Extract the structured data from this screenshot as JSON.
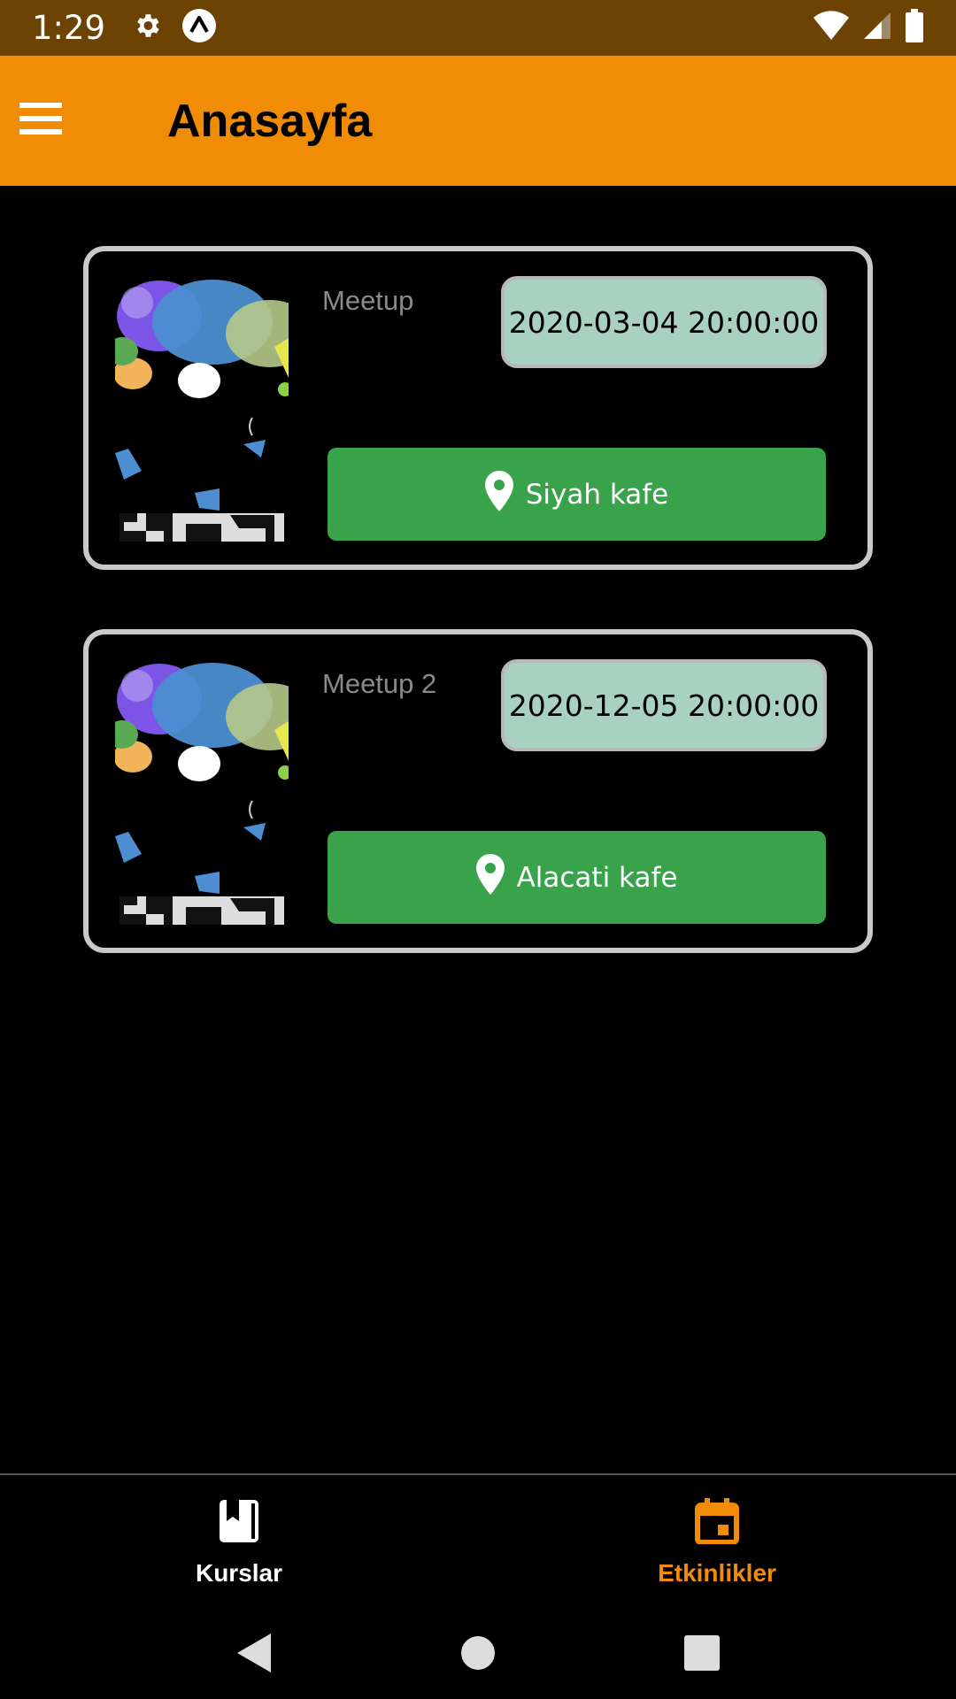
{
  "status_bar": {
    "time": "1:29",
    "left_icons": [
      "gear-icon",
      "expo-icon"
    ],
    "right_icons": [
      "wifi-icon",
      "cellular-signal-icon",
      "battery-icon"
    ]
  },
  "app_bar": {
    "title": "Anasayfa",
    "menu_icon": "hamburger-menu-icon",
    "background_color": "#f08c05"
  },
  "events": [
    {
      "name": "Meetup",
      "date": "2020-03-04 20:00:00",
      "location": "Siyah kafe",
      "image": "meetup-chat-bubbles-logo"
    },
    {
      "name": "Meetup 2",
      "date": "2020-12-05 20:00:00",
      "location": "Alacati kafe",
      "image": "meetup-chat-bubbles-logo"
    }
  ],
  "bottom_nav": {
    "items": [
      {
        "label": "Kurslar",
        "icon": "book-icon",
        "active": false
      },
      {
        "label": "Etkinlikler",
        "icon": "calendar-event-icon",
        "active": true
      }
    ],
    "active_color": "#f08c05"
  },
  "system_nav": [
    "back-icon",
    "home-icon",
    "recents-icon"
  ],
  "colors": {
    "status_bar": "#6d4303",
    "date_badge": "#a8d1c1",
    "location_button": "#38a34a",
    "card_border": "#c9c9c9"
  }
}
